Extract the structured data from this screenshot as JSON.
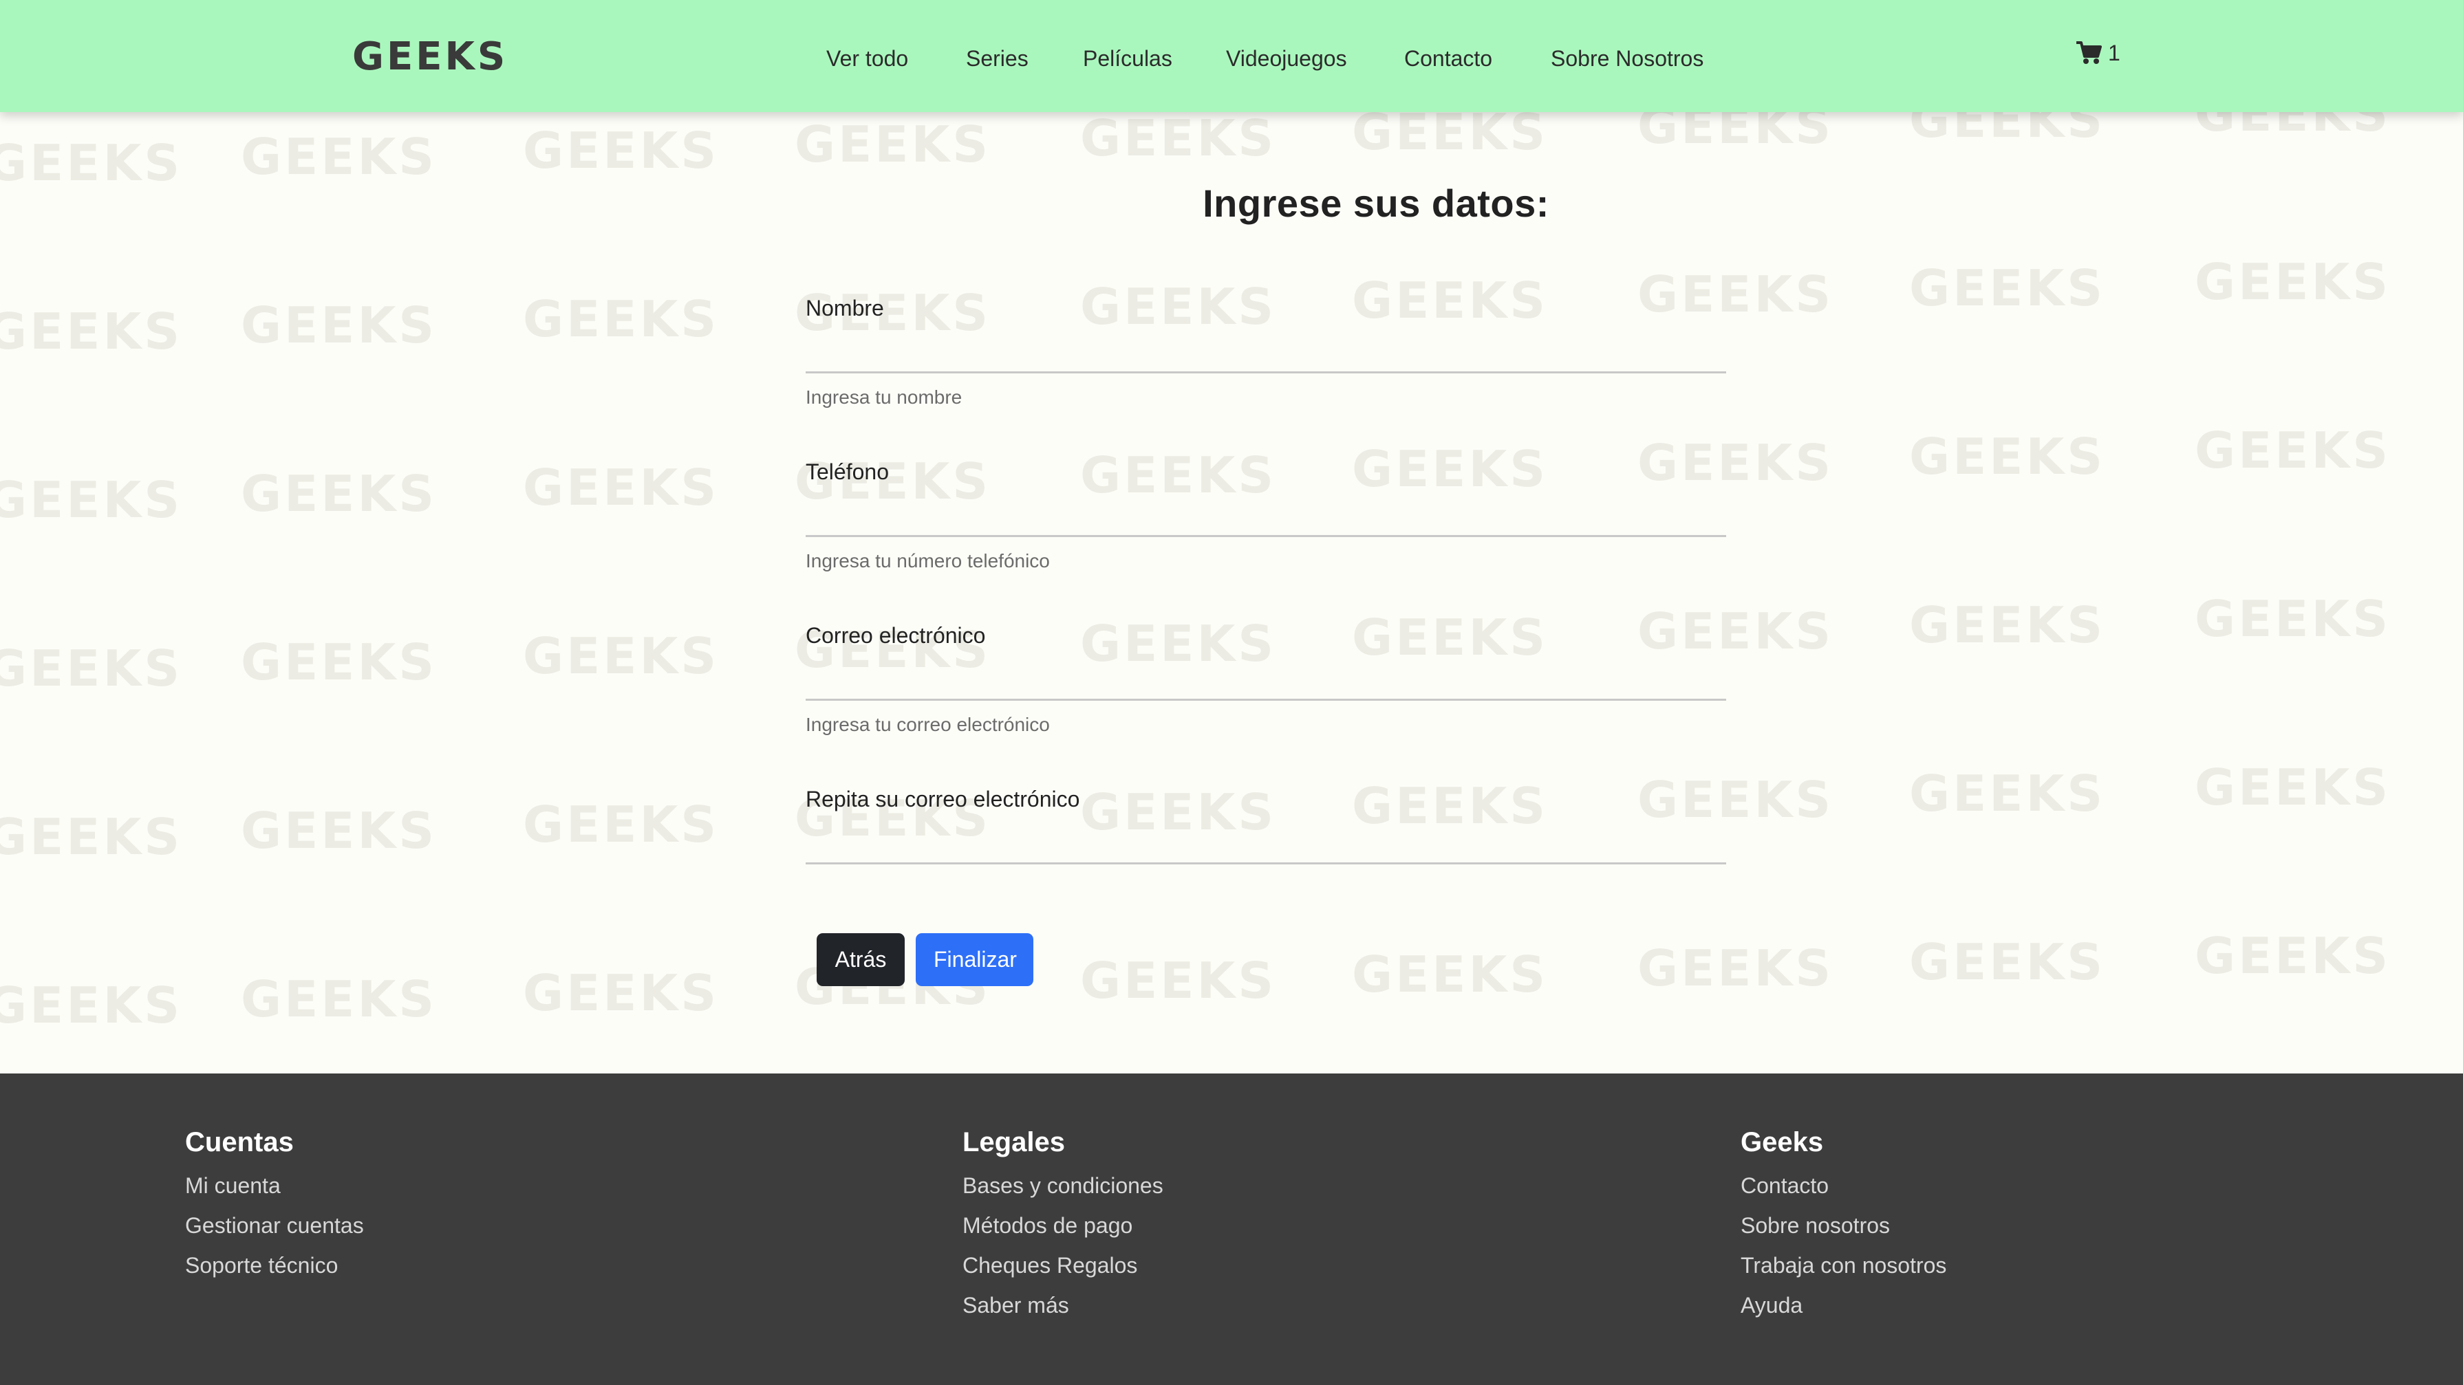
{
  "brand": {
    "logo_text": "GEEKS"
  },
  "nav": {
    "items": [
      {
        "label": "Ver todo"
      },
      {
        "label": "Series"
      },
      {
        "label": "Películas"
      },
      {
        "label": "Videojuegos"
      },
      {
        "label": "Contacto"
      },
      {
        "label": "Sobre Nosotros"
      }
    ],
    "cart": {
      "icon": "shopping-cart-icon",
      "count": "1"
    }
  },
  "background": {
    "watermark_text": "GEEKS"
  },
  "form": {
    "title": "Ingrese sus datos:",
    "fields": [
      {
        "label": "Nombre",
        "value": "",
        "help": "Ingresa tu nombre"
      },
      {
        "label": "Teléfono",
        "value": "",
        "help": "Ingresa tu número telefónico"
      },
      {
        "label": "Correo electrónico",
        "value": "",
        "help": "Ingresa tu correo electrónico"
      },
      {
        "label": "Repita su correo electrónico",
        "value": "",
        "help": ""
      }
    ],
    "back_label": "Atrás",
    "finish_label": "Finalizar"
  },
  "footer": {
    "columns": [
      {
        "title": "Cuentas",
        "links": [
          "Mi cuenta",
          "Gestionar cuentas",
          "Soporte técnico"
        ]
      },
      {
        "title": "Legales",
        "links": [
          "Bases y condiciones",
          "Métodos de pago",
          "Cheques Regalos",
          "Saber más"
        ]
      },
      {
        "title": "Geeks",
        "links": [
          "Contacto",
          "Sobre nosotros",
          "Trabaja con nosotros",
          "Ayuda"
        ]
      }
    ]
  },
  "colors": {
    "header_bg": "#aaf7bd",
    "page_bg": "#fdfdf8",
    "footer_bg": "#3d3d3d",
    "primary_button": "#2d6ff7",
    "dark_button": "#212429"
  }
}
